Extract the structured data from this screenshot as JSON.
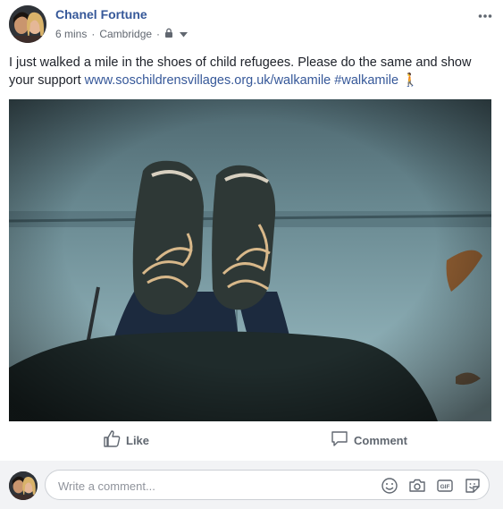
{
  "post": {
    "author": "Chanel Fortune",
    "time": "6 mins",
    "separator": "·",
    "location": "Cambridge",
    "privacy_icon": "lock-icon",
    "text_before_link": "I just walked a mile in the shoes of child refugees. Please do the same and show your support ",
    "link": "www.soschildrensvillages.org.uk/walkamile",
    "hashtag": "#walkamile",
    "emoji": "🚶",
    "image_description_icon": "photo"
  },
  "actions": {
    "like_label": "Like",
    "comment_label": "Comment"
  },
  "comment_box": {
    "placeholder": "Write a comment..."
  },
  "colors": {
    "link": "#365899",
    "meta": "#616770",
    "comment_bg": "#f2f3f5"
  }
}
